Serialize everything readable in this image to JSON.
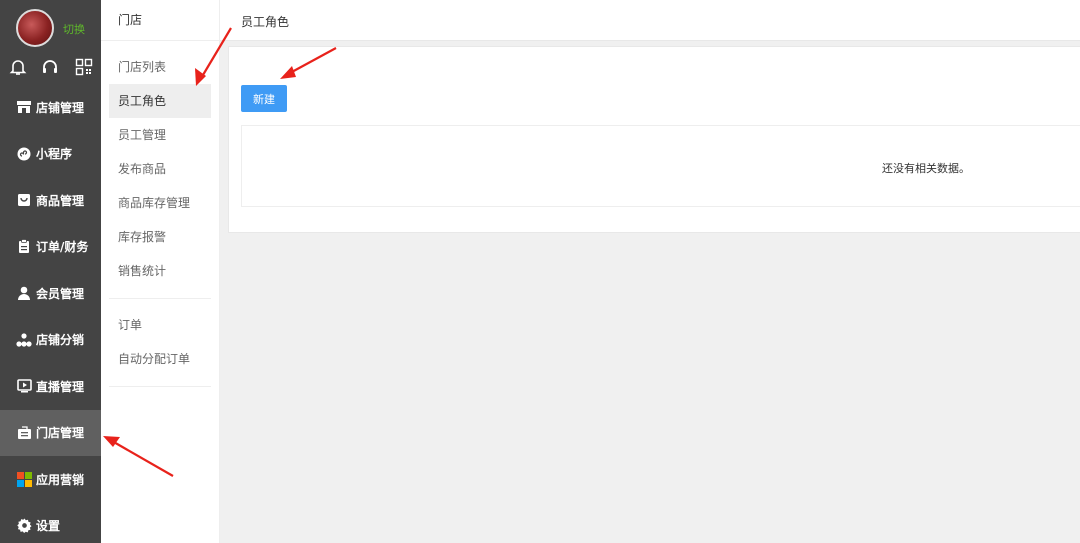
{
  "sidebar": {
    "switch_label": "切换",
    "top_icons": [
      "bell-icon",
      "headset-icon",
      "qrcode-icon"
    ],
    "items": [
      {
        "label": "店铺管理",
        "icon": "shop-icon"
      },
      {
        "label": "小程序",
        "icon": "miniprogram-icon"
      },
      {
        "label": "商品管理",
        "icon": "goods-icon"
      },
      {
        "label": "订单/财务",
        "icon": "clipboard-icon"
      },
      {
        "label": "会员管理",
        "icon": "user-icon"
      },
      {
        "label": "店铺分销",
        "icon": "distribution-icon"
      },
      {
        "label": "直播管理",
        "icon": "live-icon"
      },
      {
        "label": "门店管理",
        "icon": "store-icon",
        "active": true
      },
      {
        "label": "应用营销",
        "icon": "apps-icon"
      },
      {
        "label": "设置",
        "icon": "gear-icon"
      }
    ]
  },
  "subnav": {
    "title": "门店",
    "group1": [
      "门店列表",
      "员工角色",
      "员工管理",
      "发布商品",
      "商品库存管理",
      "库存报警",
      "销售统计"
    ],
    "group2": [
      "订单",
      "自动分配订单"
    ],
    "active": "员工角色"
  },
  "main": {
    "breadcrumb": "员工角色",
    "new_button": "新建",
    "empty_text": "还没有相关数据。"
  },
  "colors": {
    "sidebar_bg": "#444444",
    "sidebar_active": "#606060",
    "primary": "#3f9bf5",
    "switch_green": "#5fb82b",
    "arrow_red": "#e8221b"
  }
}
